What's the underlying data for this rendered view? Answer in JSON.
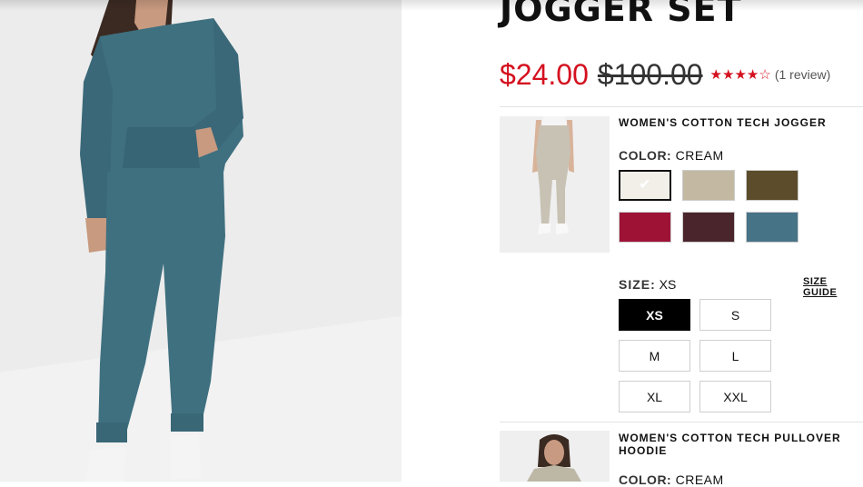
{
  "product": {
    "title": "JOGGER SET",
    "sale_price": "$24.00",
    "original_price": "$100.00",
    "rating": 4,
    "rating_max": 5,
    "review_count_label": "(1 review)"
  },
  "items": [
    {
      "name": "WOMEN'S COTTON TECH JOGGER",
      "color_key": "COLOR:",
      "color_value": "CREAM",
      "swatches": [
        {
          "name": "cream",
          "hex": "#f1efe8",
          "selected": true
        },
        {
          "name": "taupe",
          "hex": "#c3b9a2",
          "selected": false
        },
        {
          "name": "olive",
          "hex": "#5c4c2c",
          "selected": false
        },
        {
          "name": "red",
          "hex": "#9e1236",
          "selected": false
        },
        {
          "name": "burgundy",
          "hex": "#4a252b",
          "selected": false
        },
        {
          "name": "teal",
          "hex": "#477387",
          "selected": false
        }
      ],
      "size_key": "SIZE:",
      "size_value": "XS",
      "size_guide": "SIZE GUIDE",
      "sizes": [
        {
          "label": "XS",
          "selected": true
        },
        {
          "label": "S",
          "selected": false
        },
        {
          "label": "M",
          "selected": false
        },
        {
          "label": "L",
          "selected": false
        },
        {
          "label": "XL",
          "selected": false
        },
        {
          "label": "XXL",
          "selected": false
        }
      ]
    },
    {
      "name": "WOMEN'S COTTON TECH PULLOVER HOODIE",
      "color_key": "COLOR:",
      "color_value": "CREAM"
    }
  ],
  "colors": {
    "sale": "#d4111f",
    "outfit_teal": "#3f7080",
    "jogger_cream": "#c8c2b4"
  }
}
